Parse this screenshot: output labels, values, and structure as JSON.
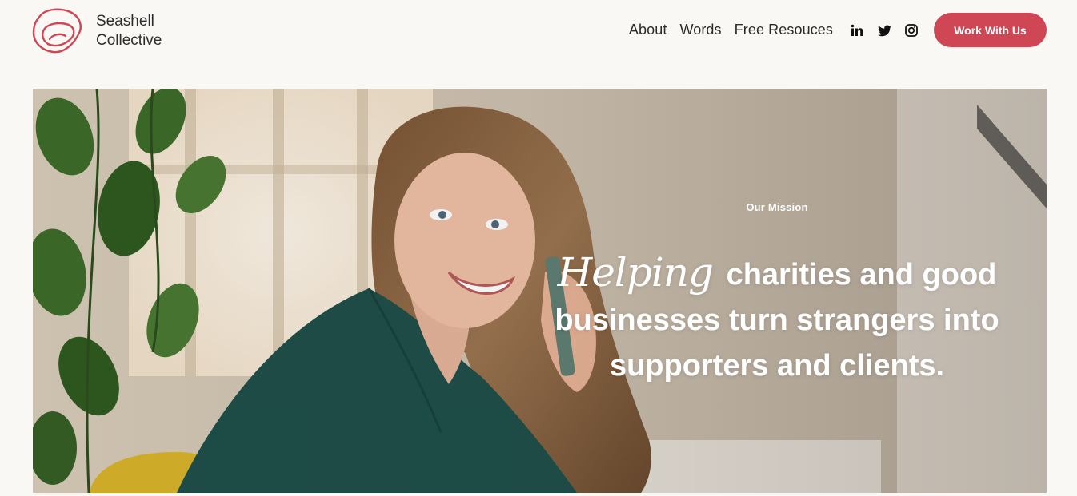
{
  "brand": {
    "line1": "Seashell",
    "line2": "Collective",
    "accent": "#cf4655"
  },
  "nav": {
    "items": [
      "About",
      "Words",
      "Free Resouces"
    ]
  },
  "social": {
    "icons": [
      "linkedin-icon",
      "twitter-icon",
      "instagram-icon"
    ]
  },
  "cta": {
    "label": "Work With Us"
  },
  "hero": {
    "eyebrow": "Our Mission",
    "headline": {
      "script_word": "Helping",
      "line1_rest": "charities and good",
      "line2": "businesses turn strangers into",
      "line3": "supporters and clients."
    },
    "image_alt": "Smiling woman with curly hair in a green sweater talking on a phone beside a plant"
  }
}
